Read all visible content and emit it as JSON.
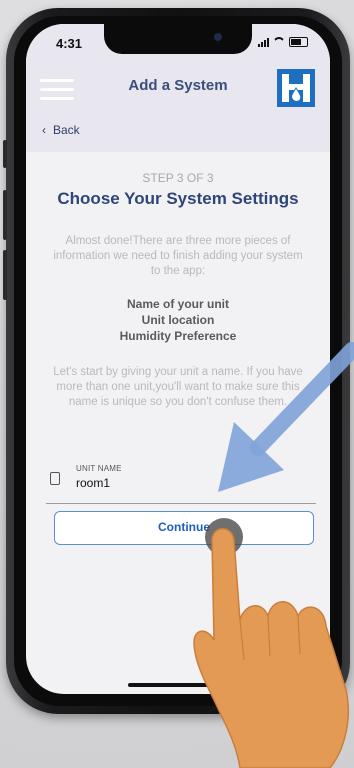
{
  "status_bar": {
    "time": "4:31"
  },
  "header": {
    "title": "Add a System",
    "back_label": "Back"
  },
  "content": {
    "step": "STEP 3 OF 3",
    "heading": "Choose Your System Settings",
    "intro": "Almost done!There are three more pieces of information we need to finish adding your system to the app:",
    "items": [
      "Name of your unit",
      "Unit location",
      "Humidity Preference"
    ],
    "instruction": "Let's start by giving your unit a name. If you have more than one unit,you'll want to make sure this name is unique so you don't confuse them."
  },
  "field": {
    "label": "UNIT NAME",
    "value": "room1"
  },
  "button": {
    "label": "Continue"
  },
  "colors": {
    "accent": "#1f6fc0",
    "heading": "#2f4677",
    "arrow": "#7fa3d9",
    "hand": "#e39a55"
  },
  "icons": [
    "menu-icon",
    "logo-icon",
    "back-chevron-icon",
    "device-icon",
    "pointer-arrow",
    "tap-hand"
  ]
}
